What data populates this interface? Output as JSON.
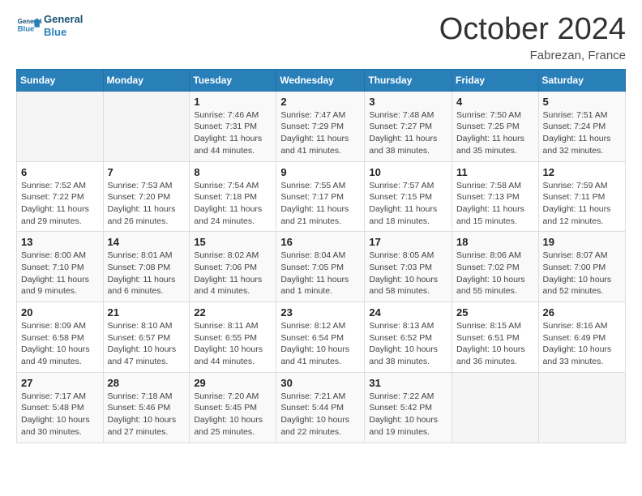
{
  "header": {
    "logo_general": "General",
    "logo_blue": "Blue",
    "month_title": "October 2024",
    "location": "Fabrezan, France"
  },
  "weekdays": [
    "Sunday",
    "Monday",
    "Tuesday",
    "Wednesday",
    "Thursday",
    "Friday",
    "Saturday"
  ],
  "weeks": [
    [
      {
        "day": "",
        "info": ""
      },
      {
        "day": "",
        "info": ""
      },
      {
        "day": "1",
        "info": "Sunrise: 7:46 AM\nSunset: 7:31 PM\nDaylight: 11 hours and 44 minutes."
      },
      {
        "day": "2",
        "info": "Sunrise: 7:47 AM\nSunset: 7:29 PM\nDaylight: 11 hours and 41 minutes."
      },
      {
        "day": "3",
        "info": "Sunrise: 7:48 AM\nSunset: 7:27 PM\nDaylight: 11 hours and 38 minutes."
      },
      {
        "day": "4",
        "info": "Sunrise: 7:50 AM\nSunset: 7:25 PM\nDaylight: 11 hours and 35 minutes."
      },
      {
        "day": "5",
        "info": "Sunrise: 7:51 AM\nSunset: 7:24 PM\nDaylight: 11 hours and 32 minutes."
      }
    ],
    [
      {
        "day": "6",
        "info": "Sunrise: 7:52 AM\nSunset: 7:22 PM\nDaylight: 11 hours and 29 minutes."
      },
      {
        "day": "7",
        "info": "Sunrise: 7:53 AM\nSunset: 7:20 PM\nDaylight: 11 hours and 26 minutes."
      },
      {
        "day": "8",
        "info": "Sunrise: 7:54 AM\nSunset: 7:18 PM\nDaylight: 11 hours and 24 minutes."
      },
      {
        "day": "9",
        "info": "Sunrise: 7:55 AM\nSunset: 7:17 PM\nDaylight: 11 hours and 21 minutes."
      },
      {
        "day": "10",
        "info": "Sunrise: 7:57 AM\nSunset: 7:15 PM\nDaylight: 11 hours and 18 minutes."
      },
      {
        "day": "11",
        "info": "Sunrise: 7:58 AM\nSunset: 7:13 PM\nDaylight: 11 hours and 15 minutes."
      },
      {
        "day": "12",
        "info": "Sunrise: 7:59 AM\nSunset: 7:11 PM\nDaylight: 11 hours and 12 minutes."
      }
    ],
    [
      {
        "day": "13",
        "info": "Sunrise: 8:00 AM\nSunset: 7:10 PM\nDaylight: 11 hours and 9 minutes."
      },
      {
        "day": "14",
        "info": "Sunrise: 8:01 AM\nSunset: 7:08 PM\nDaylight: 11 hours and 6 minutes."
      },
      {
        "day": "15",
        "info": "Sunrise: 8:02 AM\nSunset: 7:06 PM\nDaylight: 11 hours and 4 minutes."
      },
      {
        "day": "16",
        "info": "Sunrise: 8:04 AM\nSunset: 7:05 PM\nDaylight: 11 hours and 1 minute."
      },
      {
        "day": "17",
        "info": "Sunrise: 8:05 AM\nSunset: 7:03 PM\nDaylight: 10 hours and 58 minutes."
      },
      {
        "day": "18",
        "info": "Sunrise: 8:06 AM\nSunset: 7:02 PM\nDaylight: 10 hours and 55 minutes."
      },
      {
        "day": "19",
        "info": "Sunrise: 8:07 AM\nSunset: 7:00 PM\nDaylight: 10 hours and 52 minutes."
      }
    ],
    [
      {
        "day": "20",
        "info": "Sunrise: 8:09 AM\nSunset: 6:58 PM\nDaylight: 10 hours and 49 minutes."
      },
      {
        "day": "21",
        "info": "Sunrise: 8:10 AM\nSunset: 6:57 PM\nDaylight: 10 hours and 47 minutes."
      },
      {
        "day": "22",
        "info": "Sunrise: 8:11 AM\nSunset: 6:55 PM\nDaylight: 10 hours and 44 minutes."
      },
      {
        "day": "23",
        "info": "Sunrise: 8:12 AM\nSunset: 6:54 PM\nDaylight: 10 hours and 41 minutes."
      },
      {
        "day": "24",
        "info": "Sunrise: 8:13 AM\nSunset: 6:52 PM\nDaylight: 10 hours and 38 minutes."
      },
      {
        "day": "25",
        "info": "Sunrise: 8:15 AM\nSunset: 6:51 PM\nDaylight: 10 hours and 36 minutes."
      },
      {
        "day": "26",
        "info": "Sunrise: 8:16 AM\nSunset: 6:49 PM\nDaylight: 10 hours and 33 minutes."
      }
    ],
    [
      {
        "day": "27",
        "info": "Sunrise: 7:17 AM\nSunset: 5:48 PM\nDaylight: 10 hours and 30 minutes."
      },
      {
        "day": "28",
        "info": "Sunrise: 7:18 AM\nSunset: 5:46 PM\nDaylight: 10 hours and 27 minutes."
      },
      {
        "day": "29",
        "info": "Sunrise: 7:20 AM\nSunset: 5:45 PM\nDaylight: 10 hours and 25 minutes."
      },
      {
        "day": "30",
        "info": "Sunrise: 7:21 AM\nSunset: 5:44 PM\nDaylight: 10 hours and 22 minutes."
      },
      {
        "day": "31",
        "info": "Sunrise: 7:22 AM\nSunset: 5:42 PM\nDaylight: 10 hours and 19 minutes."
      },
      {
        "day": "",
        "info": ""
      },
      {
        "day": "",
        "info": ""
      }
    ]
  ]
}
